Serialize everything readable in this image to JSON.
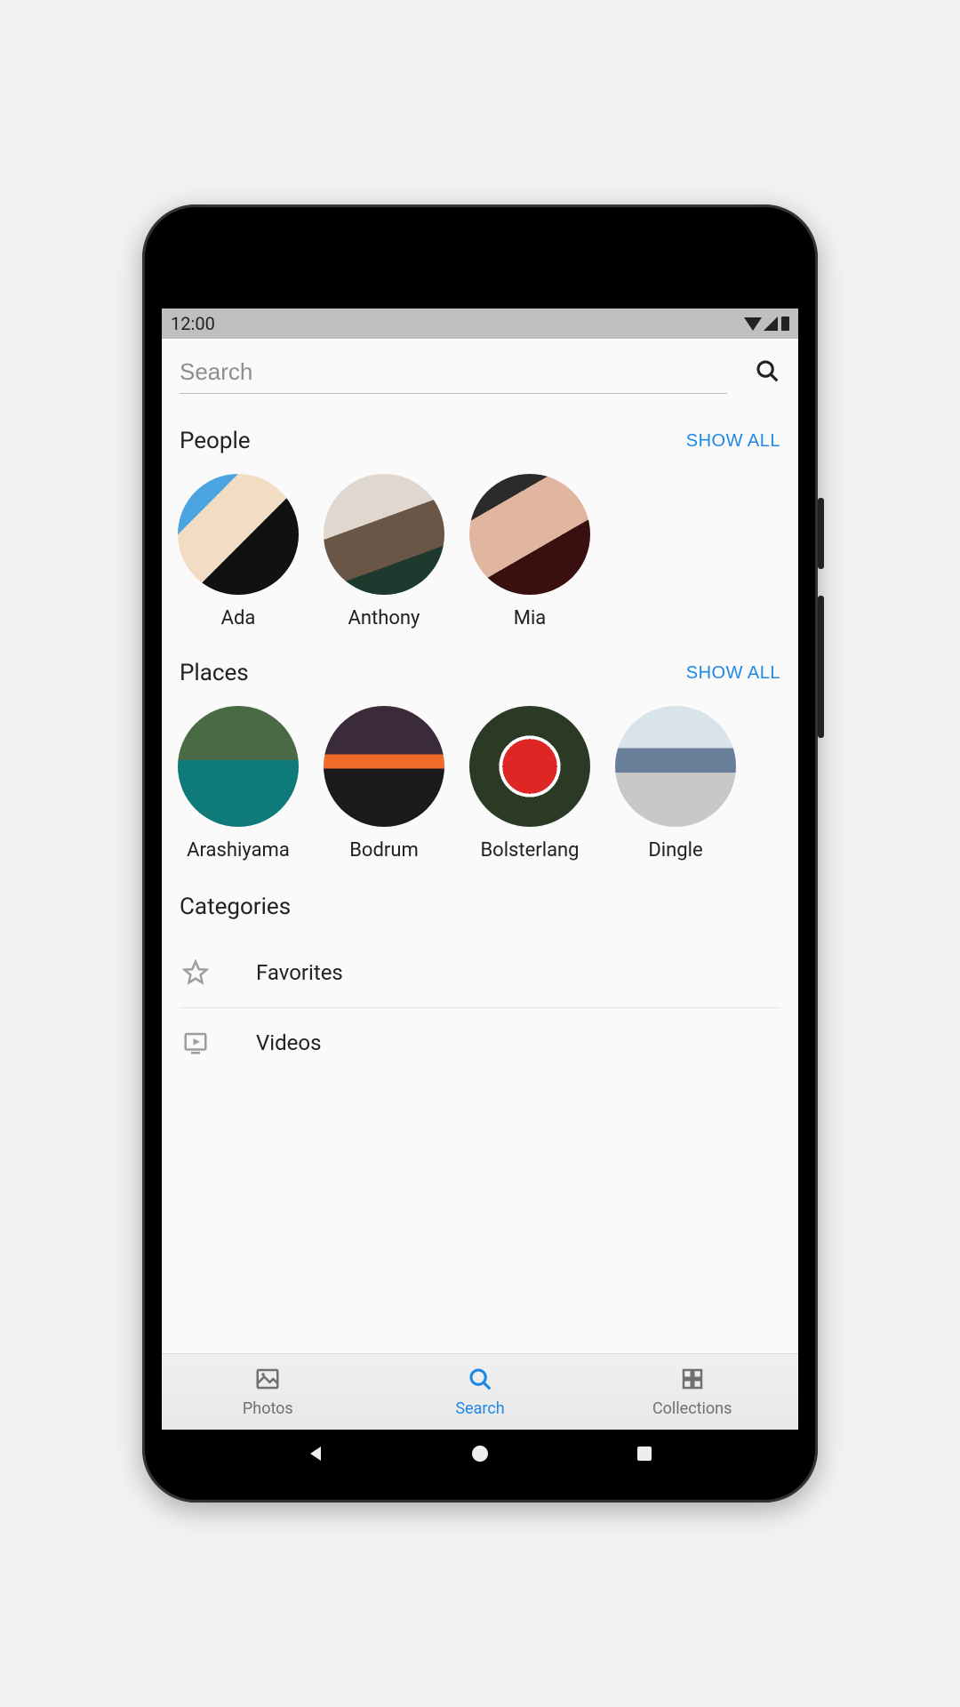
{
  "status": {
    "time": "12:00"
  },
  "search": {
    "placeholder": "Search"
  },
  "sections": {
    "people": {
      "title": "People",
      "show_all": "SHOW ALL",
      "items": [
        {
          "name": "Ada"
        },
        {
          "name": "Anthony"
        },
        {
          "name": "Mia"
        }
      ]
    },
    "places": {
      "title": "Places",
      "show_all": "SHOW ALL",
      "items": [
        {
          "name": "Arashiyama"
        },
        {
          "name": "Bodrum"
        },
        {
          "name": "Bolsterlang"
        },
        {
          "name": "Dingle"
        }
      ]
    },
    "categories": {
      "title": "Categories",
      "items": [
        {
          "icon": "star",
          "label": "Favorites"
        },
        {
          "icon": "video",
          "label": "Videos"
        }
      ]
    }
  },
  "bottom_nav": {
    "items": [
      {
        "icon": "photos",
        "label": "Photos",
        "active": false
      },
      {
        "icon": "search",
        "label": "Search",
        "active": true
      },
      {
        "icon": "collections",
        "label": "Collections",
        "active": false
      }
    ]
  },
  "accent_color": "#1e88e5"
}
